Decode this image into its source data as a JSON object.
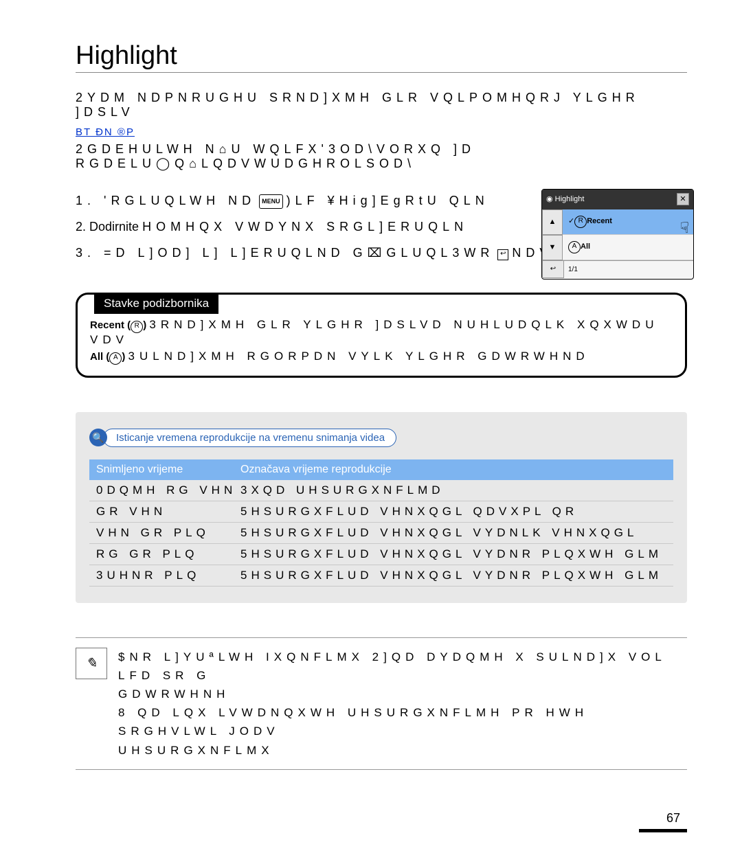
{
  "title": "Highlight",
  "intro": "2YDM NDPNRUGHU SRND]XMH GLR VQLPOMHQRJ YLGHR ]DSLV",
  "link_text": "BT ÐN ®P",
  "p2": "2GDEHULWH N⌂U WQLFX'3OD\\VORXQ ]D RGDELU◯Q⌂LQDVWUDGHROLSOD\\",
  "step1_a": "1.  'RGLUQLWH ND",
  "step1_menu": "MENU",
  "step1_b": ")LF ¥Hig]EgRtU QLN",
  "highlight_label": "Highlight",
  "step2_a": "2. Dodirnite",
  "step2_b": "HOMHQX VWDYNX SRGL]ERUQLN",
  "step3_a": "3.  =D L]OD] L] L]ERUQLND G⌧GLUQL3WR",
  "step3_b": "NDV",
  "screenshot": {
    "title": "Highlight",
    "row1": "Recent",
    "row2": "All",
    "up": "▲",
    "down": "▼",
    "close": "✕",
    "page": "1/1",
    "back": "↩"
  },
  "subbox_title": "Stavke podizbornika",
  "sub_recent_label": "Recent (",
  "sub_recent_icon": "R",
  "sub_recent_text": "3RND]XMH GLR YLGHR ]DSLVD NUHLUDQLK XQXWDU    VDV",
  "sub_all_label": "All (",
  "sub_all_icon": "A",
  "sub_all_text": "3ULND]XMH RGORPDN VYLK YLGHR GDWRWHND",
  "pb_pill": "Isticanje vremena reprodukcije na vremenu snimanja videa",
  "pb_head1": "Snimljeno vrijeme",
  "pb_head2": "Označava vrijeme reprodukcije",
  "pb_rows": [
    {
      "c1": "0DQMH RG   VHN",
      "c2": "3XQD UHSURGXNFLMD"
    },
    {
      "c1": "  GR    VHN",
      "c2": "5HSURGXFLUD   VHNXQGL QDVXPL QR"
    },
    {
      "c1": "   VHN GR   PLQ",
      "c2": "5HSURGXFLUD   VHNXQGL VYDNLK    VHNXQGL"
    },
    {
      "c1": "RG   GR    PLQ",
      "c2": "5HSURGXFLUD   VHNXQGL VYDNR   PLQXWH GLM"
    },
    {
      "c1": "3UHNR    PLQ",
      "c2": "5HSURGXFLUD   VHNXQGL VYDNR   PLQXWH GLM"
    }
  ],
  "note_line1": "$NR L]YUªLWH IXQNFLMX 2]QD DYDQMH X SULND]X VOL LFD SR G",
  "note_line1b": "GDWRWHNH",
  "note_line2": "8 QD LQX LVWDNQXWH UHSURGXNFLMH PR HWH SRGHVLWL JODV",
  "note_line2b": "UHSURGXNFLMX",
  "page_number": "67"
}
